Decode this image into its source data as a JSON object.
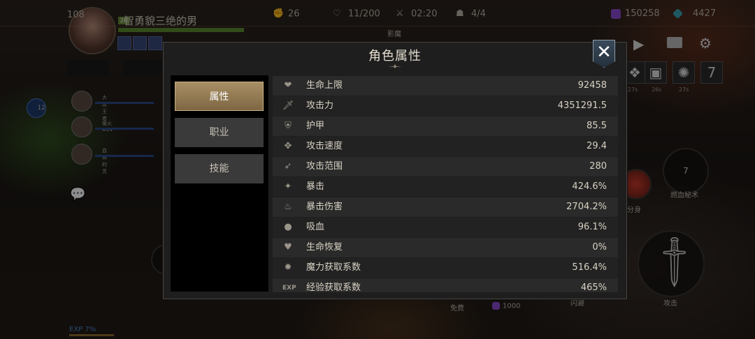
{
  "player": {
    "level": "108",
    "name": "智勇貌三绝的男",
    "level_tag": "28"
  },
  "top_stats": [
    {
      "icon": "fist-icon",
      "value": "26"
    },
    {
      "icon": "heart-icon",
      "value": "11/200"
    },
    {
      "icon": "crossed-swords-icon",
      "value": "02:20"
    },
    {
      "icon": "demon-mask-icon",
      "value": "4/4"
    }
  ],
  "currencies": [
    {
      "icon": "purple-gem-icon",
      "value": "150258",
      "color": "#8a4ad0"
    },
    {
      "icon": "blue-crystal-icon",
      "value": "4427",
      "color": "#3aa0b0"
    }
  ],
  "zone_label": "影魔",
  "party": [
    {
      "name": "大叔王者"
    },
    {
      "name": "缓火#24"
    },
    {
      "name": "血煞的灵"
    }
  ],
  "party_badge": "12",
  "skill_cooldowns": [
    "27s",
    "26s",
    "27s"
  ],
  "skill_button_7": "7",
  "right_buttons": {
    "blood_secret_count": "7",
    "blood_secret_label": "燃血秘术",
    "clone_label": "分身",
    "attack_label": "攻击",
    "dodge_label": "闪避"
  },
  "bottom": {
    "free_label": "免费",
    "cost_value": "1000",
    "exp_label": "EXP 7%"
  },
  "modal": {
    "title": "角色属性",
    "close_label": "✕",
    "tabs": [
      {
        "label": "属性",
        "active": true
      },
      {
        "label": "职业",
        "active": false
      },
      {
        "label": "技能",
        "active": false
      }
    ],
    "stats": [
      {
        "icon": "heart-icon",
        "glyph": "❤",
        "label": "生命上限",
        "value": "92458"
      },
      {
        "icon": "sword-icon",
        "glyph": "🗡",
        "label": "攻击力",
        "value": "4351291.5"
      },
      {
        "icon": "shield-icon",
        "glyph": "⛨",
        "label": "护甲",
        "value": "85.5"
      },
      {
        "icon": "speed-icon",
        "glyph": "✥",
        "label": "攻击速度",
        "value": "29.4"
      },
      {
        "icon": "range-icon",
        "glyph": "➶",
        "label": "攻击范围",
        "value": "280"
      },
      {
        "icon": "crit-icon",
        "glyph": "✦",
        "label": "暴击",
        "value": "424.6%"
      },
      {
        "icon": "crit-damage-icon",
        "glyph": "♨",
        "label": "暴击伤害",
        "value": "2704.2%"
      },
      {
        "icon": "lifesteal-icon",
        "glyph": "●",
        "label": "吸血",
        "value": "96.1%"
      },
      {
        "icon": "regen-icon",
        "glyph": "♥",
        "label": "生命恢复",
        "value": "0%"
      },
      {
        "icon": "mana-bomb-icon",
        "glyph": "✹",
        "label": "魔力获取系数",
        "value": "516.4%"
      },
      {
        "icon": "exp-icon",
        "glyph": "EXP",
        "label": "经验获取系数",
        "value": "465%"
      }
    ]
  }
}
